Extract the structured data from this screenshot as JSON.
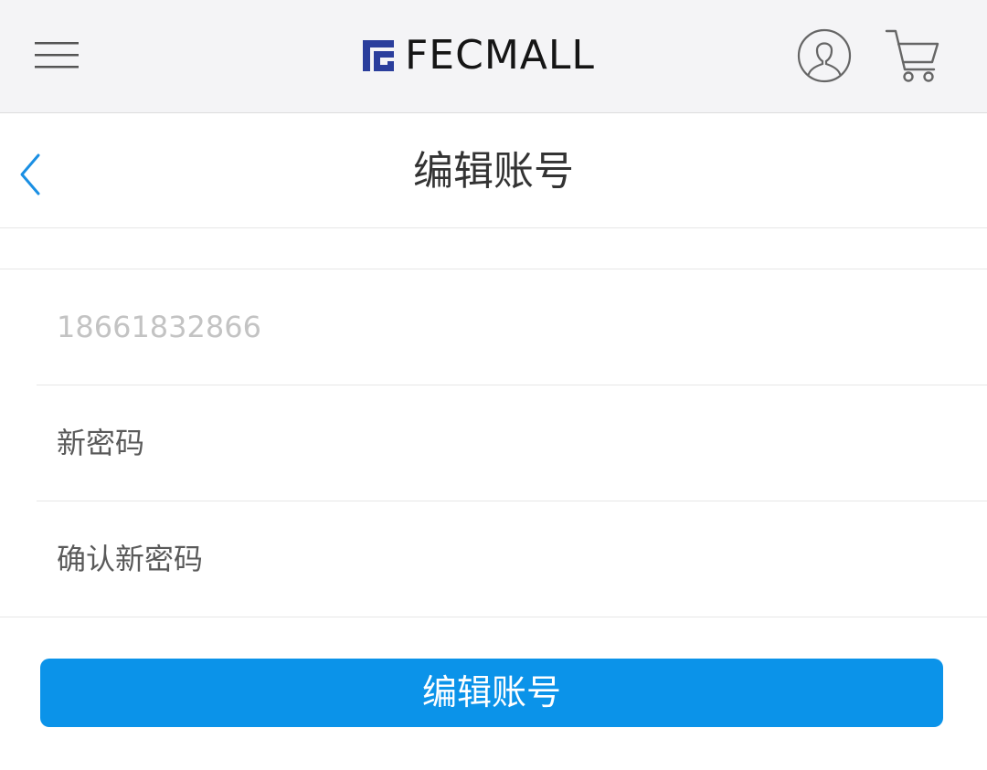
{
  "header": {
    "brand": "FECMALL",
    "icons": {
      "menu": "hamburger-menu-icon",
      "account": "user-account-icon",
      "cart": "shopping-cart-icon"
    }
  },
  "title_bar": {
    "title": "编辑账号",
    "back_icon": "chevron-left-icon"
  },
  "form": {
    "phone": {
      "placeholder": "18661832866"
    },
    "new_password": {
      "placeholder": "新密码"
    },
    "confirm_password": {
      "placeholder": "确认新密码"
    }
  },
  "submit_label": "编辑账号",
  "colors": {
    "accent": "#0b93e9",
    "logo_mark": "#2a3e9c",
    "header_bg": "#f4f4f6"
  }
}
